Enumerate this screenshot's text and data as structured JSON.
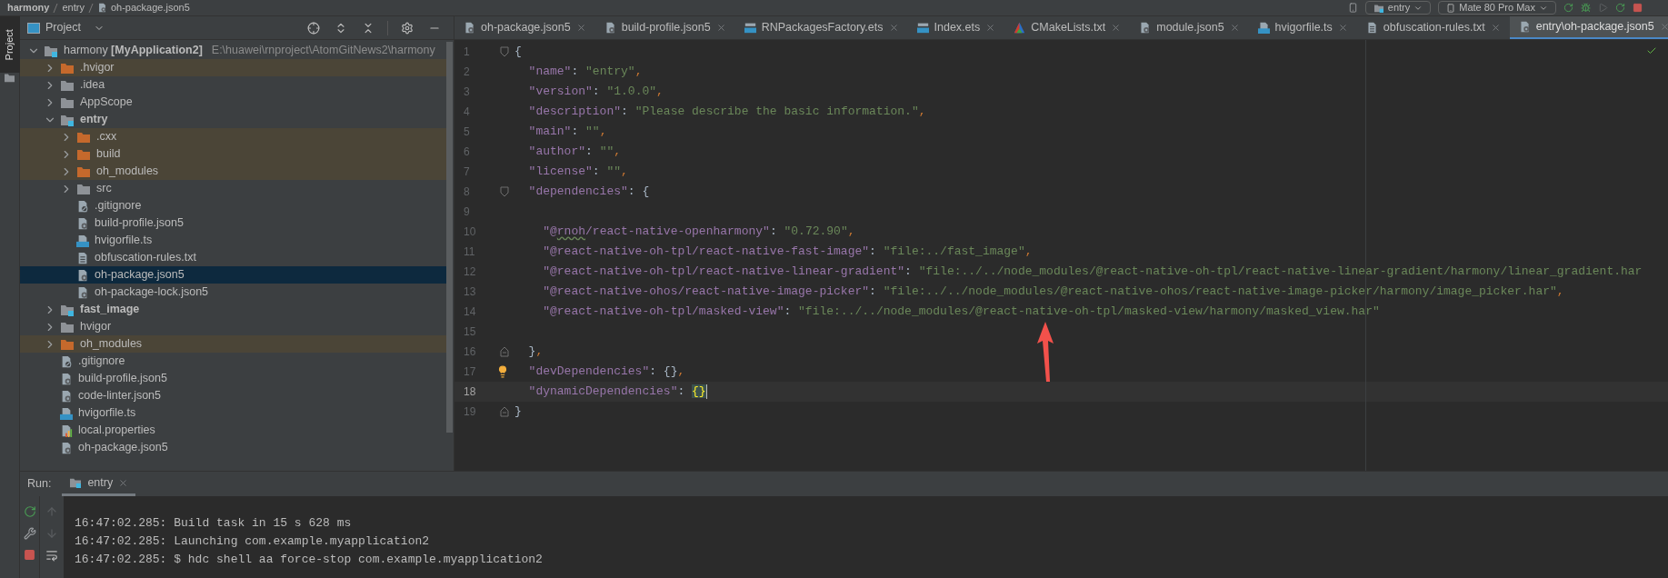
{
  "breadcrumbs": [
    {
      "label": "harmony",
      "kind": "folder"
    },
    {
      "label": "entry",
      "kind": "folder"
    },
    {
      "label": "oh-package.json5",
      "kind": "json"
    }
  ],
  "run_config": {
    "label": "entry"
  },
  "device": {
    "label": "Mate 80 Pro Max"
  },
  "side_strip": {
    "label": "Project"
  },
  "project_panel": {
    "title": "Project"
  },
  "tree": [
    {
      "label": "harmony **[MyApplication2]**",
      "path": "E:\\huawei\\rnproject\\AtomGitNews2\\harmony",
      "kind": "project",
      "expanded": true,
      "selected": false,
      "children": [
        {
          "label": ".hvigor",
          "kind": "excluded_folder",
          "expanded": false,
          "selected": false
        },
        {
          "label": ".idea",
          "kind": "folder",
          "expanded": false,
          "selected": false
        },
        {
          "label": "AppScope",
          "kind": "folder",
          "expanded": false,
          "selected": false
        },
        {
          "label": "entry",
          "kind": "module",
          "expanded": true,
          "selected": false,
          "children": [
            {
              "label": ".cxx",
              "kind": "excluded_folder",
              "expanded": false,
              "selected": false
            },
            {
              "label": "build",
              "kind": "excluded_folder",
              "expanded": false,
              "selected": false
            },
            {
              "label": "oh_modules",
              "kind": "excluded_folder",
              "expanded": false,
              "selected": false
            },
            {
              "label": "src",
              "kind": "folder",
              "expanded": false,
              "selected": false
            },
            {
              "label": ".gitignore",
              "kind": "git",
              "selected": false
            },
            {
              "label": "build-profile.json5",
              "kind": "json",
              "selected": false
            },
            {
              "label": "hvigorfile.ts",
              "kind": "ts",
              "selected": false
            },
            {
              "label": "obfuscation-rules.txt",
              "kind": "txt",
              "selected": false
            },
            {
              "label": "oh-package.json5",
              "kind": "json",
              "selected": true
            },
            {
              "label": "oh-package-lock.json5",
              "kind": "json",
              "selected": false
            }
          ]
        },
        {
          "label": "fast_image",
          "kind": "module",
          "expanded": false,
          "selected": false
        },
        {
          "label": "hvigor",
          "kind": "folder",
          "expanded": false,
          "selected": false
        },
        {
          "label": "oh_modules",
          "kind": "excluded_folder",
          "expanded": false,
          "selected": false
        },
        {
          "label": ".gitignore",
          "kind": "git",
          "selected": false
        },
        {
          "label": "build-profile.json5",
          "kind": "json",
          "selected": false
        },
        {
          "label": "code-linter.json5",
          "kind": "json",
          "selected": false
        },
        {
          "label": "hvigorfile.ts",
          "kind": "ts",
          "selected": false
        },
        {
          "label": "local.properties",
          "kind": "properties",
          "selected": false
        },
        {
          "label": "oh-package.json5",
          "kind": "json",
          "selected": false
        }
      ]
    }
  ],
  "editor_tabs": [
    {
      "label": "oh-package.json5",
      "kind": "json",
      "selected": false
    },
    {
      "label": "build-profile.json5",
      "kind": "json",
      "selected": false
    },
    {
      "label": "RNPackagesFactory.ets",
      "kind": "ets",
      "selected": false
    },
    {
      "label": "Index.ets",
      "kind": "ets",
      "selected": false
    },
    {
      "label": "CMakeLists.txt",
      "kind": "cmake",
      "selected": false
    },
    {
      "label": "module.json5",
      "kind": "json",
      "selected": false
    },
    {
      "label": "hvigorfile.ts",
      "kind": "ts",
      "selected": false
    },
    {
      "label": "obfuscation-rules.txt",
      "kind": "txt",
      "selected": false
    },
    {
      "label": "entry\\oh-package.json5",
      "kind": "json",
      "selected": true
    }
  ],
  "code_lines": [
    {
      "number": "1",
      "fold_open": true,
      "tokens": [
        {
          "kind": "plain",
          "text": "{"
        }
      ]
    },
    {
      "number": "2",
      "tokens": [
        {
          "kind": "key",
          "text": "  \"name\""
        },
        {
          "kind": "plain",
          "text": ": "
        },
        {
          "kind": "string",
          "text": "\"entry\""
        },
        {
          "kind": "punct",
          "text": ","
        }
      ]
    },
    {
      "number": "3",
      "tokens": [
        {
          "kind": "key",
          "text": "  \"version\""
        },
        {
          "kind": "plain",
          "text": ": "
        },
        {
          "kind": "string",
          "text": "\"1.0.0\""
        },
        {
          "kind": "punct",
          "text": ","
        }
      ]
    },
    {
      "number": "4",
      "tokens": [
        {
          "kind": "key",
          "text": "  \"description\""
        },
        {
          "kind": "plain",
          "text": ": "
        },
        {
          "kind": "string",
          "text": "\"Please describe the basic information.\""
        },
        {
          "kind": "punct",
          "text": ","
        }
      ]
    },
    {
      "number": "5",
      "tokens": [
        {
          "kind": "key",
          "text": "  \"main\""
        },
        {
          "kind": "plain",
          "text": ": "
        },
        {
          "kind": "string",
          "text": "\"\""
        },
        {
          "kind": "punct",
          "text": ","
        }
      ]
    },
    {
      "number": "6",
      "tokens": [
        {
          "kind": "key",
          "text": "  \"author\""
        },
        {
          "kind": "plain",
          "text": ": "
        },
        {
          "kind": "string",
          "text": "\"\""
        },
        {
          "kind": "punct",
          "text": ","
        }
      ]
    },
    {
      "number": "7",
      "tokens": [
        {
          "kind": "key",
          "text": "  \"license\""
        },
        {
          "kind": "plain",
          "text": ": "
        },
        {
          "kind": "string",
          "text": "\"\""
        },
        {
          "kind": "punct",
          "text": ","
        }
      ]
    },
    {
      "number": "8",
      "fold_open": true,
      "tokens": [
        {
          "kind": "key",
          "text": "  \"dependencies\""
        },
        {
          "kind": "plain",
          "text": ": {"
        }
      ]
    },
    {
      "number": "9"
    },
    {
      "number": "10",
      "tokens": [
        {
          "kind": "key",
          "text": "    \"@"
        },
        {
          "kind": "typo",
          "text": "rnoh"
        },
        {
          "kind": "key",
          "text": "/react-native-openharmony\""
        },
        {
          "kind": "plain",
          "text": ": "
        },
        {
          "kind": "string",
          "text": "\"0.72.90\""
        },
        {
          "kind": "punct",
          "text": ","
        }
      ]
    },
    {
      "number": "11",
      "tokens": [
        {
          "kind": "key",
          "text": "    \"@react-native-oh-tpl/react-native-fast-image\""
        },
        {
          "kind": "plain",
          "text": ": "
        },
        {
          "kind": "string",
          "text": "\"file:../fast_image\""
        },
        {
          "kind": "punct",
          "text": ","
        }
      ]
    },
    {
      "number": "12",
      "tokens": [
        {
          "kind": "key",
          "text": "    \"@react-native-oh-tpl/react-native-linear-gradient\""
        },
        {
          "kind": "plain",
          "text": ": "
        },
        {
          "kind": "string",
          "text": "\"file:../../node_modules/@react-native-oh-tpl/react-native-linear-gradient/harmony/linear_gradient.har"
        }
      ]
    },
    {
      "number": "13",
      "tokens": [
        {
          "kind": "key",
          "text": "    \"@react-native-ohos/react-native-image-picker\""
        },
        {
          "kind": "plain",
          "text": ": "
        },
        {
          "kind": "string",
          "text": "\"file:../../node_modules/@react-native-ohos/react-native-image-picker/harmony/image_picker.har\""
        },
        {
          "kind": "punct",
          "text": ","
        }
      ]
    },
    {
      "number": "14",
      "tokens": [
        {
          "kind": "key",
          "text": "    \"@react-native-oh-tpl/masked-view\""
        },
        {
          "kind": "plain",
          "text": ": "
        },
        {
          "kind": "string",
          "text": "\"file:../../node_modules/@react-native-oh-tpl/masked-view/harmony/masked_view.har\""
        }
      ]
    },
    {
      "number": "15"
    },
    {
      "number": "16",
      "fold_close": true,
      "tokens": [
        {
          "kind": "plain",
          "text": "  }"
        },
        {
          "kind": "punct",
          "text": ","
        }
      ]
    },
    {
      "number": "17",
      "bulb": true,
      "tokens": [
        {
          "kind": "key",
          "text": "  \"devDependencies\""
        },
        {
          "kind": "plain",
          "text": ": {}"
        },
        {
          "kind": "punct",
          "text": ","
        }
      ]
    },
    {
      "number": "18",
      "current": true,
      "tokens": [
        {
          "kind": "key",
          "text": "  \"dynamicDependencies\""
        },
        {
          "kind": "plain",
          "text": ": "
        },
        {
          "kind": "matched",
          "text": "{}"
        }
      ]
    },
    {
      "number": "19",
      "fold_close": true,
      "tokens": [
        {
          "kind": "plain",
          "text": "}"
        }
      ]
    }
  ],
  "run_panel": {
    "label": "Run:",
    "tabs": [
      {
        "label": "entry",
        "selected": true
      }
    ],
    "console": [
      "16:47:02.285: Build task in 15 s 628 ms",
      "16:47:02.285: Launching com.example.myapplication2",
      "16:47:02.285: $ hdc shell aa force-stop com.example.myapplication2"
    ]
  }
}
